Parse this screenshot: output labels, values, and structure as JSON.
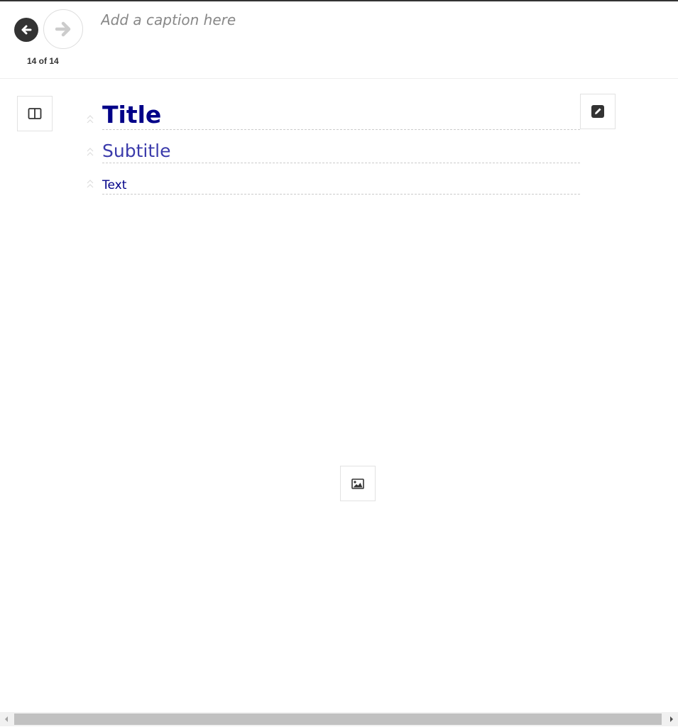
{
  "header": {
    "prev_icon": "arrow-left-icon",
    "next_icon": "arrow-right-icon",
    "counter": "14 of 14",
    "caption_placeholder": "Add a caption here"
  },
  "toolbar": {
    "layout_icon": "columns-icon",
    "edit_icon": "pencil-square-icon",
    "image_icon": "image-icon"
  },
  "fields": {
    "title": "Title",
    "subtitle": "Subtitle",
    "text": "Text"
  },
  "colors": {
    "title": "#000088",
    "subtitle": "#3b3bab",
    "text": "#000088",
    "dark": "#333333"
  }
}
